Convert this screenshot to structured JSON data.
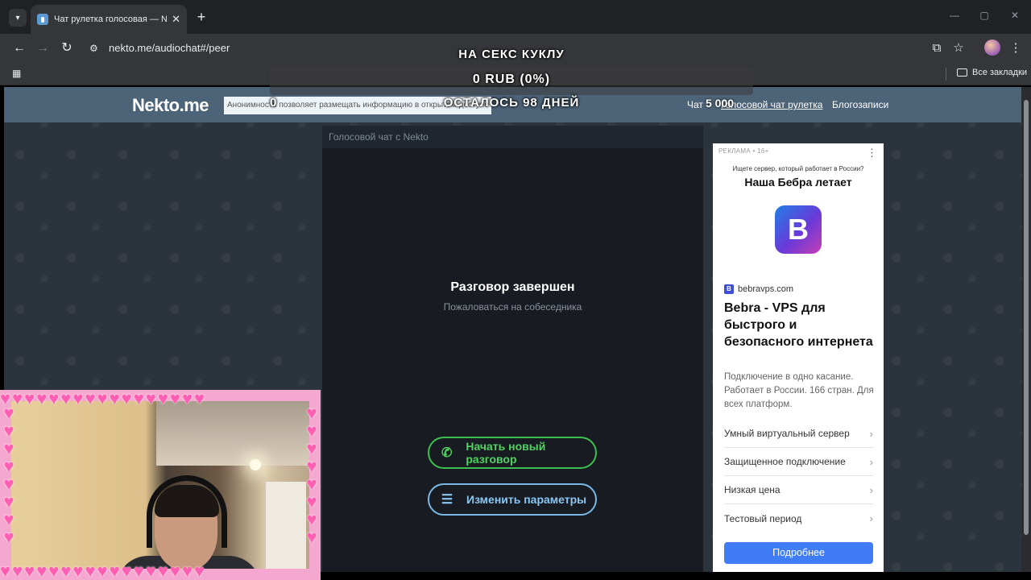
{
  "browser": {
    "tab_title": "Чат рулетка голосовая — Nekto",
    "url": "nekto.me/audiochat#/peer",
    "bookmarks_all": "Все закладки"
  },
  "site": {
    "logo": "Nekto.me",
    "notice": "Анонимность позволяет размещать информацию в открытом доступе",
    "nav": {
      "chat": "Чат",
      "voice_roulette": "Голосовой чат рулетка",
      "blog": "Блогозаписи"
    }
  },
  "chat": {
    "header": "Голосовой чат с Nekto",
    "status": "Разговор завершен",
    "report": "Пожаловаться на собеседника",
    "new_chat": "Начать новый разговор",
    "change_params": "Изменить параметры"
  },
  "ad": {
    "tag": "РЕКЛАМА • 16+",
    "question": "Ищете сервер, который работает в России?",
    "headline": "Наша Бебра летает",
    "logo_letter": "B",
    "domain": "bebravps.com",
    "title": "Bebra - VPS для быстрого и безопасного интернета",
    "description": "Подключение в одно касание. Работает в России. 166 стран. Для всех платформ.",
    "features": [
      "Умный виртуальный сервер",
      "Защищенное подключение",
      "Низкая цена",
      "Тестовый период"
    ],
    "cta": "Подробнее"
  },
  "overlay": {
    "goal": "НА СЕКС КУКЛУ",
    "amount": "0 RUB (0%)",
    "progress_percent": 0,
    "remaining_prefix": "0",
    "remaining": "ОСТАЛОСЬ 98 ДНЕЙ",
    "counter": "5 000"
  }
}
